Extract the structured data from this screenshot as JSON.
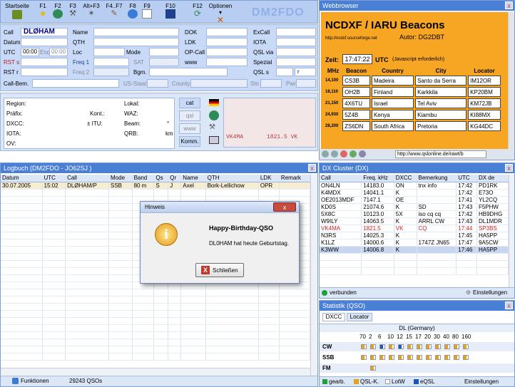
{
  "toolbar": {
    "items": [
      "Startseite",
      "F1",
      "F2",
      "F3",
      "Alt+F3",
      "F4..F7",
      "F8",
      "F9",
      "F10",
      "F12",
      "Optionen"
    ],
    "brand": "DM2FDO"
  },
  "qso": {
    "call_label": "Call",
    "call_value": "DLØHAM",
    "datum_label": "Datum",
    "utc_label": "UTC",
    "utc_value": "00:00",
    "ende_label": "Ende",
    "ende_value": "00:00",
    "rsts_label": "RST s",
    "rstr_label": "RST r",
    "callbem_label": "Call-Bem.",
    "name_label": "Name",
    "qth_label": "QTH",
    "loc_label": "Loc",
    "freq1_label": "Freq 1",
    "freq2_label": "Freq 2",
    "bgm_label": "Bgm.",
    "mode_label": "Mode",
    "sat_label": "SAT",
    "usstaat_label": "US-Staat",
    "county_label": "County",
    "dok_label": "DOK",
    "ldk_label": "LDK",
    "opcall_label": "OP-Call",
    "www_label": "www",
    "excall_label": "ExCall",
    "iota_label": "IOTA",
    "qslvia_label": "QSL via",
    "spezial_label": "Spezial",
    "qsls_label": "QSL s",
    "qsls_val": "r",
    "stn_label": "Stn",
    "pwr_label": "Pwr"
  },
  "info": {
    "labels_left": [
      "Region:",
      "Präfix:",
      "DXCC:",
      "IOTA:",
      "OV:"
    ],
    "kont": "Kont.:",
    "itu": "± ITU:",
    "lokal": "Lokal:",
    "waz": "WAZ:",
    "beam": "Beam:",
    "beam_unit": "°",
    "qrb": "QRB:",
    "qrb_unit": "km",
    "btns": [
      "cat",
      "qsl",
      "www",
      "Komm."
    ],
    "scope_call": "VK4MA",
    "scope_freq": "1821.5  VK"
  },
  "webbrowser": {
    "title": "Webbrowser",
    "heading": "NCDXF / IARU Beacons",
    "link": "http://ncdxf.sourceforge.net",
    "autor": "Autor: DG2DBT",
    "zeit_label": "Zeit:",
    "zeit_value": "17:47:22",
    "utc": "UTC",
    "js": "(Javascript erforderlich)",
    "cols": [
      "MHz",
      "Beacon",
      "Country",
      "City",
      "Locator"
    ],
    "rows": [
      [
        "14,100",
        "CS3B",
        "Madeira",
        "Santo da Serra",
        "IM12OR"
      ],
      [
        "18,110",
        "OH2B",
        "Finland",
        "Karkkila",
        "KP20BM"
      ],
      [
        "21,150",
        "4X6TU",
        "Israel",
        "Tel Aviv",
        "KM72JB"
      ],
      [
        "24,930",
        "5Z4B",
        "Kenya",
        "Kiambu",
        "KI88MX"
      ],
      [
        "28,200",
        "ZS6DN",
        "South Africa",
        "Pretoria",
        "KG44DC"
      ]
    ],
    "url": "http://www.qslonline.de/rawt/b"
  },
  "logbuch": {
    "title": "Logbuch  (DM2FDO - JO62SJ )",
    "cols": [
      "Datum",
      "UTC",
      "Call",
      "Mode",
      "Band",
      "Qs",
      "Qr",
      "Name",
      "QTH",
      "LDK",
      "Remark"
    ],
    "row": [
      "30.07.2005",
      "15:02",
      "DLØHAM/P",
      "SSB",
      "80 m",
      "S",
      "J",
      "Axel",
      "Bork-Lellichow",
      "OPR",
      ""
    ],
    "footer_funktionen": "Funktionen",
    "footer_count": "29243 QSOs"
  },
  "dialog": {
    "title": "Hinweis",
    "heading": "Happy-Birthday-QSO",
    "message": "DL0HAM hat heute Geburtstag.",
    "button": "Schließen"
  },
  "dxcluster": {
    "title": "DX Cluster (DX)",
    "cols": [
      "Call",
      "Freq. kHz",
      "DXCC",
      "Bemerkung",
      "UTC",
      "DX de"
    ],
    "rows": [
      [
        "ON4LN",
        "14183.0",
        "ON",
        "tnx info",
        "17:42",
        "PD1RK"
      ],
      [
        "K4MDX",
        "14041.1",
        "K",
        "",
        "17:42",
        "E73O"
      ],
      [
        "OE2013MDF",
        "7147.1",
        "OE",
        "",
        "17:41",
        "YL2CQ"
      ],
      [
        "KD0S",
        "21074.6",
        "K",
        "SD",
        "17:43",
        "F5PHW"
      ],
      [
        "5X8C",
        "10123.0",
        "5X",
        "iso cq cq",
        "17:42",
        "HB9DHG"
      ],
      [
        "W9ILY",
        "14063.5",
        "K",
        "ARRL CW",
        "17:43",
        "DL1MDR"
      ],
      [
        "VK4MA",
        "1821.5",
        "VK",
        "CQ",
        "17:44",
        "SP3BS"
      ],
      [
        "N3RS",
        "14025.3",
        "K",
        "",
        "17:45",
        "HA5PP"
      ],
      [
        "K1LZ",
        "14000.6",
        "K",
        "1747Z JN65",
        "17:47",
        "9A5CW"
      ],
      [
        "K3WW",
        "14006.8",
        "K",
        "",
        "17:46",
        "HA5PP"
      ]
    ],
    "status": "verbunden",
    "settings": "Einstellungen",
    "highlight_color": "#d42020"
  },
  "statistik": {
    "title": "Statistik (QSO)",
    "tabs": [
      "DXCC",
      "Locator"
    ],
    "region": "DL (Germany)",
    "bands": [
      "70",
      "2",
      "6",
      "10",
      "12",
      "15",
      "17",
      "20",
      "30",
      "40",
      "80",
      "160"
    ],
    "modes": [
      "CW",
      "SSB",
      "FM"
    ],
    "legend": [
      "gearb.",
      "QSL-K.",
      "LotW",
      "eQSL",
      "Einstellungen"
    ]
  }
}
